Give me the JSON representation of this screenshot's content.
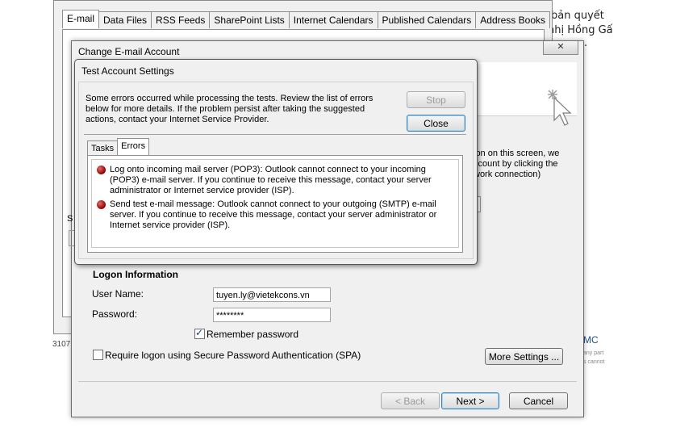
{
  "background_doc": {
    "lines": [
      "bản quyết",
      "nhị Hồng Gấ",
      "."
    ],
    "mc_label": "MC",
    "small_lines": [
      "any part",
      "s cannot"
    ],
    "status_number": "3107"
  },
  "account_settings": {
    "tabs": [
      "E-mail",
      "Data Files",
      "RSS Feeds",
      "SharePoint Lists",
      "Internet Calendars",
      "Published Calendars",
      "Address Books"
    ],
    "active_tab": "E-mail"
  },
  "change_account": {
    "title": "Change E-mail Account",
    "close_label": "✕",
    "hidden_label": "S",
    "right_text": [
      "ion on this screen, we",
      "ccount by clicking the",
      "work connection)"
    ],
    "logon": {
      "section_title": "Logon Information",
      "user_label": "User Name:",
      "user_value": "tuyen.ly@vietekcons.vn",
      "password_label": "Password:",
      "password_value": "********",
      "remember_label": "Remember password",
      "remember_checked": true,
      "spa_label": "Require logon using Secure Password Authentication (SPA)",
      "spa_checked": false
    },
    "more_settings_label": "More Settings ...",
    "back_label": "< Back",
    "next_label": "Next >",
    "cancel_label": "Cancel"
  },
  "test_dialog": {
    "title": "Test Account Settings",
    "message": "Some errors occurred while processing the tests. Review the list of errors below for more details. If the problem persist after taking the suggested actions, contact your Internet Service Provider.",
    "stop_label": "Stop",
    "close_label": "Close",
    "tabs": [
      "Tasks",
      "Errors"
    ],
    "active_tab": "Errors",
    "errors": [
      "Log onto incoming mail server (POP3): Outlook cannot connect to your incoming (POP3) e-mail server. If you continue to receive this message, contact your server administrator or Internet service provider (ISP).",
      "Send test e-mail message: Outlook cannot connect to your outgoing (SMTP) e-mail server. If you continue to receive this message, contact your server administrator or Internet service provider (ISP)."
    ]
  },
  "colors": {
    "error_icon": "#b00000",
    "window_bg": "#f0f0f0",
    "default_button_border": "#3c7fb1"
  }
}
